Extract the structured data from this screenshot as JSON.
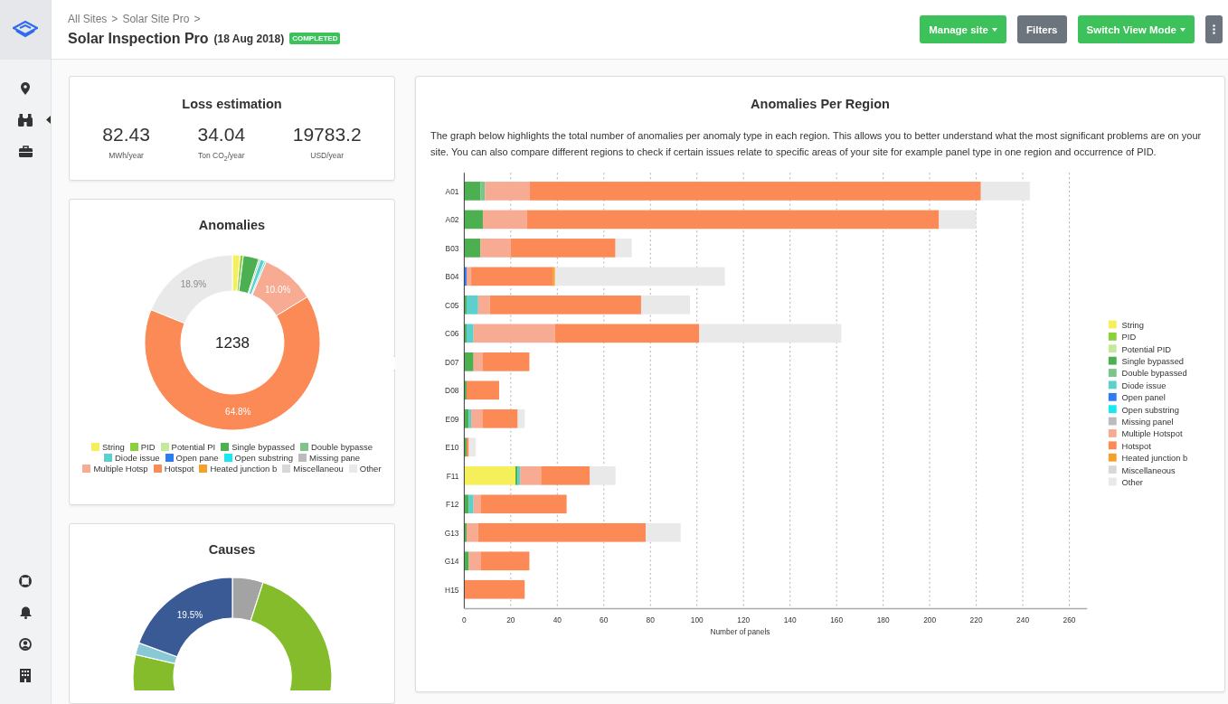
{
  "breadcrumb": [
    {
      "label": "All Sites",
      "separator": ">"
    },
    {
      "label": "Solar Site Pro",
      "separator": ">"
    }
  ],
  "page": {
    "title": "Solar Inspection Pro",
    "date": "(18 Aug 2018)",
    "status": "COMPLETED"
  },
  "toolbar": [
    {
      "label": "Manage site",
      "kind": "dropdown"
    },
    {
      "label": "Filters",
      "kind": "secondary"
    },
    {
      "label": "Switch View Mode",
      "kind": "dropdown"
    },
    {
      "kind": "more"
    }
  ],
  "loss_estimation": {
    "title": "Loss estimation",
    "metrics": [
      {
        "value": "82.43",
        "unit": "MWh/year"
      },
      {
        "value": "34.04",
        "unit": "Ton CO$_{2}$/year"
      },
      {
        "value": "19783.2",
        "unit": "USD/year"
      }
    ]
  },
  "anomalies": {
    "title": "Anomalies",
    "total": "1238",
    "chart_data": {
      "type": "donut",
      "categories": [
        "String",
        "PID",
        "Potential PI",
        "Single bypassed",
        "Double bypasse",
        "Diode issue",
        "Open pane",
        "Open substring",
        "Missing pane",
        "Multiple Hotsp",
        "Hotspot",
        "Heated junction b",
        "Miscellaneou",
        "Other"
      ],
      "values": [
        1.4,
        0.6,
        0,
        2.9,
        0.3,
        0.8,
        0,
        0.3,
        0,
        10.0,
        64.8,
        0,
        0,
        18.9
      ],
      "value_labels": [
        null,
        null,
        null,
        null,
        null,
        null,
        null,
        null,
        null,
        "10.0%",
        "64.8%",
        null,
        null,
        "18.9%"
      ]
    }
  },
  "causes": {
    "title": "Causes",
    "slice_label": "19.5%"
  },
  "anomalies_per_region": {
    "title": "Anomalies Per Region",
    "description": "The graph below highlights the total number of anomalies per anomaly type in each region. This allows you to better understand what the most significant problems are on your site. You can also compare different regions to check if certain issues relate to specific areas of your site for example panel type in one region and occurrence of PID.",
    "chart_data": {
      "type": "bar",
      "orientation": "horizontal",
      "stacked": true,
      "grid": true,
      "legend": true,
      "xlabel": "Number of panels",
      "xlim": [
        0,
        260
      ],
      "xticks": [
        0,
        20,
        40,
        60,
        80,
        100,
        120,
        140,
        160,
        180,
        200,
        220,
        240,
        260
      ],
      "categories": [
        "A01",
        "A02",
        "B03",
        "B04",
        "C05",
        "C06",
        "D07",
        "D08",
        "E09",
        "E10",
        "F11",
        "F12",
        "G13",
        "G14",
        "H15"
      ],
      "series": [
        {
          "name": "String",
          "color": "#f5ef5a",
          "values": [
            0,
            0,
            0,
            0,
            0,
            0,
            0,
            0,
            0,
            0,
            22,
            0,
            0,
            0,
            0
          ]
        },
        {
          "name": "PID",
          "color": "#8bd13d",
          "values": [
            0,
            0,
            0,
            0,
            0,
            0,
            0,
            0,
            0,
            0,
            0,
            0,
            0,
            0,
            0
          ]
        },
        {
          "name": "Potential PID",
          "color": "#c4e89c",
          "values": [
            0,
            0,
            0,
            0,
            0,
            0,
            0,
            0,
            0,
            0,
            0,
            0,
            0,
            0,
            0
          ]
        },
        {
          "name": "Single bypassed",
          "color": "#4caf50",
          "values": [
            7,
            8,
            7,
            0,
            1,
            1,
            4,
            1,
            2,
            1,
            1,
            2,
            1,
            2,
            0
          ]
        },
        {
          "name": "Double bypassed",
          "color": "#7cc48a",
          "values": [
            2,
            0,
            0,
            0,
            0,
            0,
            0,
            0,
            0,
            0,
            0,
            0,
            0,
            0,
            0
          ]
        },
        {
          "name": "Diode issue",
          "color": "#5bd0cc",
          "values": [
            0,
            0,
            0,
            0,
            5,
            3,
            0,
            0,
            1,
            0,
            1,
            2,
            0,
            0,
            0
          ]
        },
        {
          "name": "Open panel",
          "color": "#2e7df0",
          "values": [
            0,
            0,
            0,
            1,
            0,
            0,
            0,
            0,
            0,
            0,
            0,
            0,
            0,
            0,
            0
          ]
        },
        {
          "name": "Open substring",
          "color": "#19e8f0",
          "values": [
            0,
            0,
            0,
            0,
            0,
            0,
            0,
            0,
            0,
            0,
            0,
            0,
            0,
            0,
            0
          ]
        },
        {
          "name": "Missing panel",
          "color": "#bbbbbb",
          "values": [
            0,
            0,
            0,
            0,
            0,
            0,
            0,
            0,
            0,
            0,
            0,
            0,
            0,
            0,
            0
          ]
        },
        {
          "name": "Multiple Hotspot",
          "color": "#f6ab92",
          "values": [
            19,
            19,
            13,
            2,
            5,
            35,
            4,
            0,
            5,
            0,
            9,
            3,
            5,
            5,
            0
          ]
        },
        {
          "name": "Hotspot",
          "color": "#fc8a56",
          "values": [
            194,
            177,
            45,
            35,
            65,
            62,
            20,
            14,
            15,
            1,
            21,
            37,
            72,
            21,
            26
          ]
        },
        {
          "name": "Heated junction b",
          "color": "#f5a02a",
          "values": [
            0,
            0,
            0,
            1,
            0,
            0,
            0,
            0,
            0,
            0,
            0,
            0,
            0,
            0,
            0
          ]
        },
        {
          "name": "Miscellaneous",
          "color": "#d8d8d8",
          "values": [
            0,
            0,
            0,
            0,
            0,
            0,
            0,
            0,
            0,
            0,
            0,
            0,
            0,
            0,
            0
          ]
        },
        {
          "name": "Other",
          "color": "#e9e9e9",
          "values": [
            21,
            16,
            7,
            73,
            21,
            61,
            0,
            0,
            3,
            3,
            11,
            0,
            15,
            0,
            0
          ]
        }
      ]
    }
  }
}
